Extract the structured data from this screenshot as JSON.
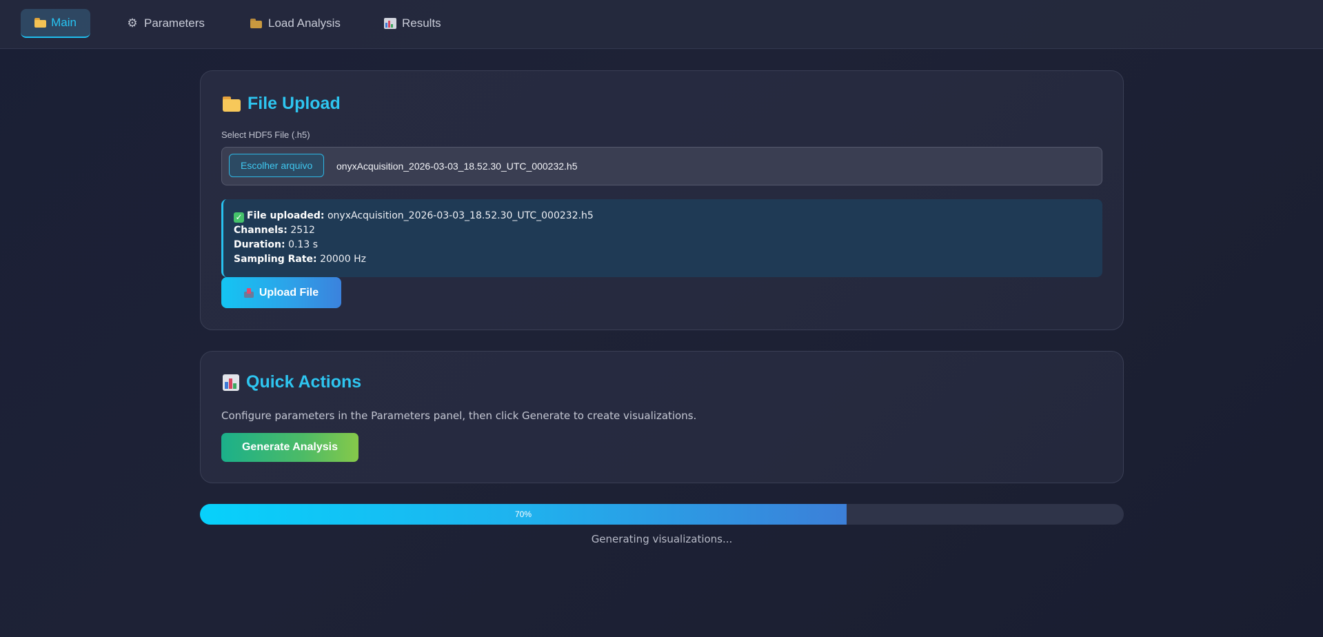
{
  "nav": {
    "tabs": [
      {
        "label": "Main",
        "icon": "folder-icon",
        "active": true
      },
      {
        "label": "Parameters",
        "icon": "gear-icon",
        "active": false
      },
      {
        "label": "Load Analysis",
        "icon": "open-folder-icon",
        "active": false
      },
      {
        "label": "Results",
        "icon": "bar-chart-icon",
        "active": false
      }
    ]
  },
  "upload": {
    "title": "File Upload",
    "field_label": "Select HDF5 File (.h5)",
    "choose_button": "Escolher arquivo",
    "selected_file": "onyxAcquisition_2026-03-03_18.52.30_UTC_000232.h5",
    "status": {
      "uploaded_label": "File uploaded:",
      "uploaded_value": "onyxAcquisition_2026-03-03_18.52.30_UTC_000232.h5",
      "channels_label": "Channels:",
      "channels_value": "2512",
      "duration_label": "Duration:",
      "duration_value": "0.13 s",
      "rate_label": "Sampling Rate:",
      "rate_value": "20000 Hz"
    },
    "upload_button": "Upload File"
  },
  "actions": {
    "title": "Quick Actions",
    "description": "Configure parameters in the Parameters panel, then click Generate to create visualizations.",
    "generate_button": "Generate Analysis"
  },
  "progress": {
    "percent": 70,
    "label": "70%",
    "status_text": "Generating visualizations..."
  },
  "colors": {
    "accent": "#27c4f2",
    "success": "#45c26a",
    "background": "#1c2033"
  }
}
